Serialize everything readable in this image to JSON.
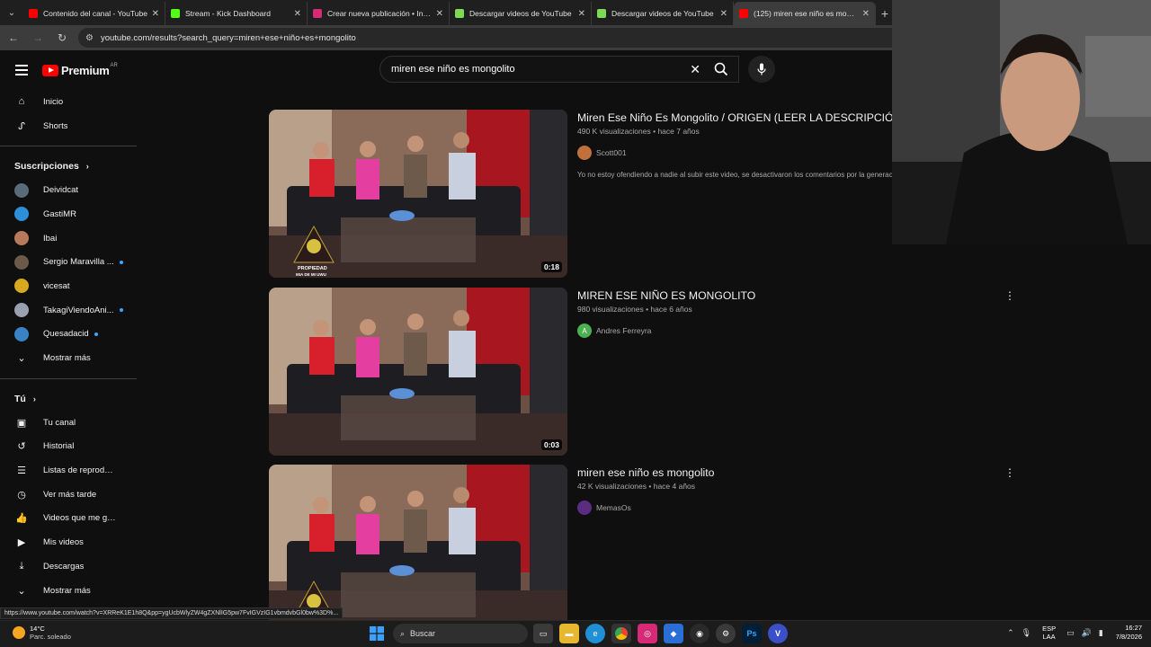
{
  "browser": {
    "tabs": [
      {
        "title": "Contenido del canal - YouTube",
        "color": "#ff0000",
        "active": false
      },
      {
        "title": "Stream - Kick Dashboard",
        "color": "#53fc18",
        "active": false
      },
      {
        "title": "Crear nueva publicación • Insta",
        "color": "#d62976",
        "active": false
      },
      {
        "title": "Descargar videos de YouTube",
        "color": "#7ed957",
        "active": false
      },
      {
        "title": "Descargar videos de YouTube",
        "color": "#7ed957",
        "active": false
      },
      {
        "title": "(125) miren ese niño es mongo",
        "color": "#ff0000",
        "active": true
      }
    ],
    "url": "youtube.com/results?search_query=miren+ese+niño+es+mongolito"
  },
  "header": {
    "logo_text": "Premium",
    "country_code": "AR",
    "search_value": "miren ese niño es mongolito"
  },
  "sidebar": {
    "main": [
      {
        "label": "Inicio",
        "icon": "home-icon",
        "glyph": "⌂"
      },
      {
        "label": "Shorts",
        "icon": "shorts-icon",
        "glyph": "ᔑ"
      }
    ],
    "subscriptions_title": "Suscripciones",
    "subscriptions": [
      {
        "label": "Deividcat",
        "avatar_color": "#5a6b7a",
        "dot": false
      },
      {
        "label": "GastiMR",
        "avatar_color": "#2d8fd8",
        "dot": false
      },
      {
        "label": "Ibai",
        "avatar_color": "#b77a5c",
        "dot": false
      },
      {
        "label": "Sergio Maravilla ...",
        "avatar_color": "#6b5a4a",
        "dot": true
      },
      {
        "label": "vicesat",
        "avatar_color": "#d8a820",
        "dot": false
      },
      {
        "label": "TakagiViendoAni...",
        "avatar_color": "#9aa0b0",
        "dot": true
      },
      {
        "label": "Quesadacid",
        "avatar_color": "#3a82c8",
        "dot": true
      }
    ],
    "show_more_1": "Mostrar más",
    "you_title": "Tú",
    "you": [
      {
        "label": "Tu canal",
        "icon": "channel-icon",
        "glyph": "▣"
      },
      {
        "label": "Historial",
        "icon": "history-icon",
        "glyph": "↺"
      },
      {
        "label": "Listas de reproducc...",
        "icon": "playlists-icon",
        "glyph": "☰"
      },
      {
        "label": "Ver más tarde",
        "icon": "watch-later-icon",
        "glyph": "◷"
      },
      {
        "label": "Videos que me gus...",
        "icon": "like-icon",
        "glyph": "👍"
      },
      {
        "label": "Mis videos",
        "icon": "my-videos-icon",
        "glyph": "▶"
      },
      {
        "label": "Descargas",
        "icon": "download-icon",
        "glyph": "⤓"
      }
    ],
    "show_more_2": "Mostrar más"
  },
  "results": [
    {
      "title": "Miren Ese Niño Es Mongolito / ORIGEN (LEER LA DESCRIPCIÓN).",
      "meta": "490 K visualizaciones • hace 7 años",
      "channel": "Scott001",
      "channel_color": "#c0703a",
      "channel_initial": "",
      "description": "Yo no estoy ofendiendo a nadie al subir este video, se desactivaron los comentarios por la generaci",
      "duration": "0:18",
      "show_menu": false
    },
    {
      "title": "MIREN ESE NIÑO ES MONGOLITO",
      "meta": "980 visualizaciones • hace 6 años",
      "channel": "Andres Ferreyra",
      "channel_color": "#4caf50",
      "channel_initial": "A",
      "description": "",
      "duration": "0:03",
      "show_menu": true
    },
    {
      "title": "miren ese niño es mongolito",
      "meta": "42 K visualizaciones • hace 4 años",
      "channel": "MemasOs",
      "channel_color": "#5a2d82",
      "channel_initial": "",
      "description": "",
      "duration": "",
      "show_menu": true
    }
  ],
  "thumb_overlay": {
    "line1": "PROPIEDAD",
    "line2": "MIA DE MI UWU"
  },
  "status_url": "https://www.youtube.com/watch?v=XRReK1E1h8Q&pp=ygUcbWlyZW4gZXNlIG5pw7FvIGVzIG1vbmdvbGl0bw%3D%...",
  "taskbar": {
    "temp": "14°C",
    "weather": "Parc. soleado",
    "search_label": "Buscar",
    "lang1": "ESP",
    "lang2": "LAA",
    "time": "16:27",
    "date": "7/8/2026"
  }
}
